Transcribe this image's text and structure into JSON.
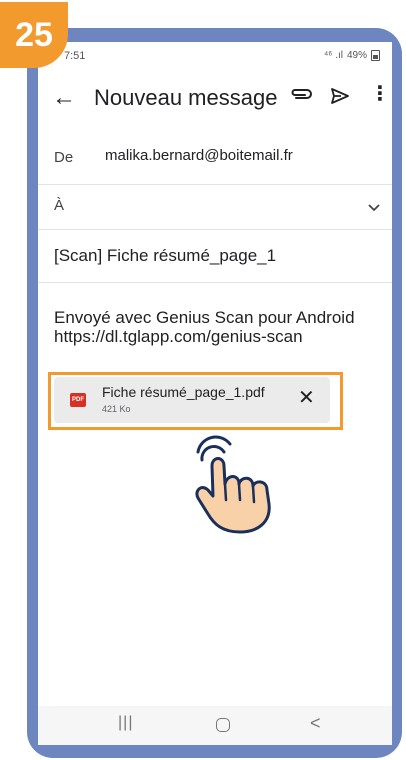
{
  "step_number": "25",
  "status_bar": {
    "time": "7:51",
    "signal": "⁴⁶ .ıl",
    "battery": "49%"
  },
  "app_bar": {
    "title": "Nouveau message"
  },
  "from": {
    "label": "De",
    "value": "malika.bernard@boitemail.fr"
  },
  "to": {
    "label": "À"
  },
  "subject": {
    "value": "[Scan] Fiche résumé_page_1"
  },
  "body": {
    "line1": "Envoyé avec Genius Scan pour Android",
    "line2": "https://dl.tglapp.com/genius-scan"
  },
  "attachment": {
    "type_label": "PDF",
    "name": "Fiche résumé_page_1.pdf",
    "size": "421 Ko"
  },
  "nav_bar": {
    "recents": "|||",
    "back": "<"
  },
  "colors": {
    "accent": "#f29a2e",
    "frame": "#6e86bf",
    "pdf_red": "#d93025",
    "attachment_bg": "#ebebeb"
  }
}
